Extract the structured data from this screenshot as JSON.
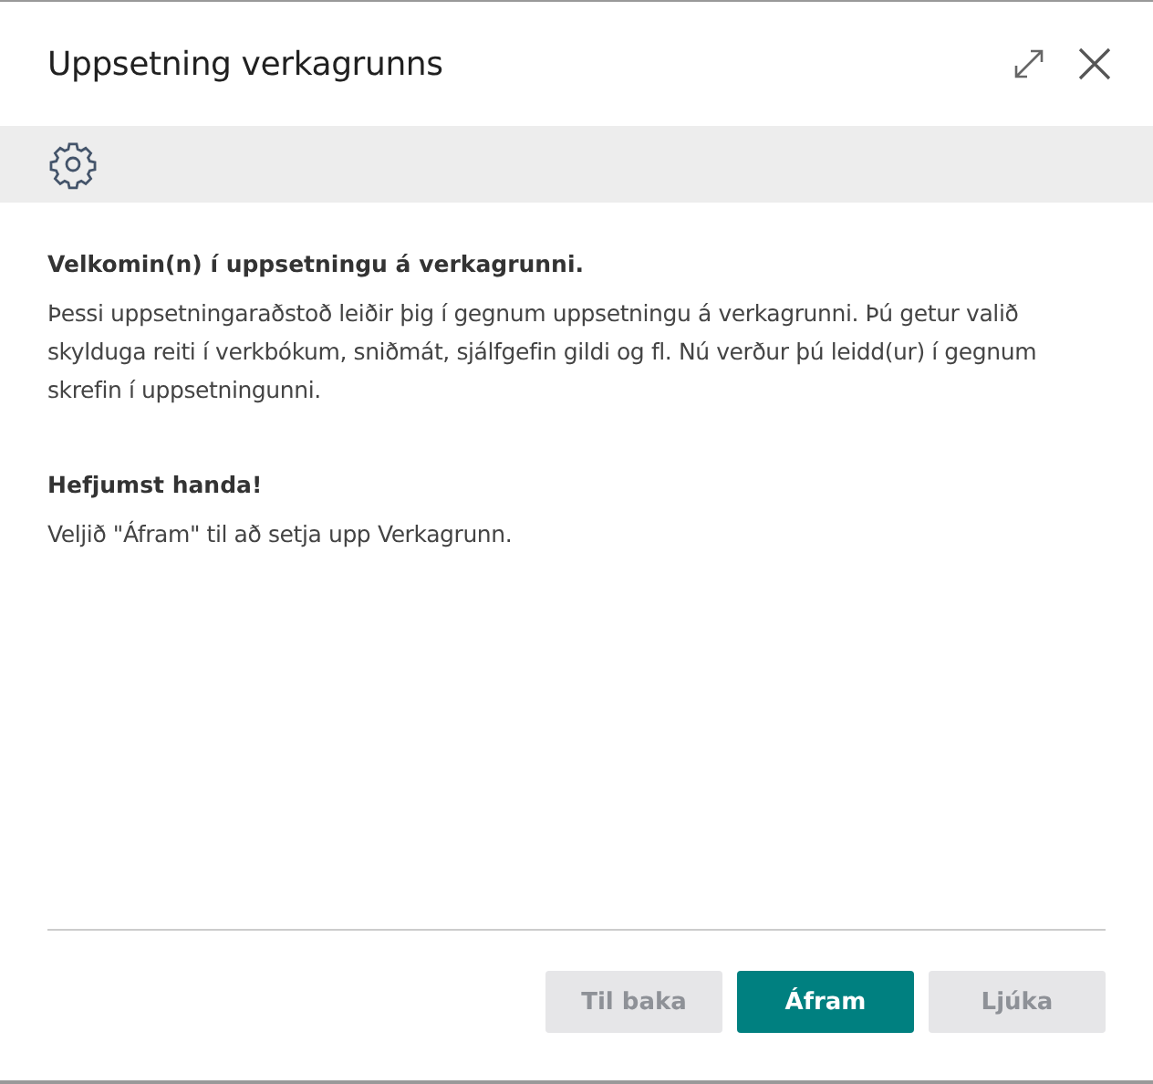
{
  "dialog": {
    "title": "Uppsetning verkagrunns"
  },
  "sections": [
    {
      "heading": "Velkomin(n) í uppsetningu á verkagrunni.",
      "body": "Þessi uppsetningaraðstoð leiðir þig í gegnum uppsetningu á verkagrunni. Þú getur valið skylduga reiti í verkbókum, sniðmát, sjálfgefin gildi og fl. Nú verður þú leidd(ur) í gegnum skrefin í uppsetningunni."
    },
    {
      "heading": "Hefjumst handa!",
      "body": "Veljið \"Áfram\" til að setja upp Verkagrunn."
    }
  ],
  "buttons": [
    {
      "label": "Til baka",
      "kind": "secondary",
      "disabled": true
    },
    {
      "label": "Áfram",
      "kind": "primary",
      "disabled": false
    },
    {
      "label": "Ljúka",
      "kind": "secondary",
      "disabled": true
    }
  ]
}
